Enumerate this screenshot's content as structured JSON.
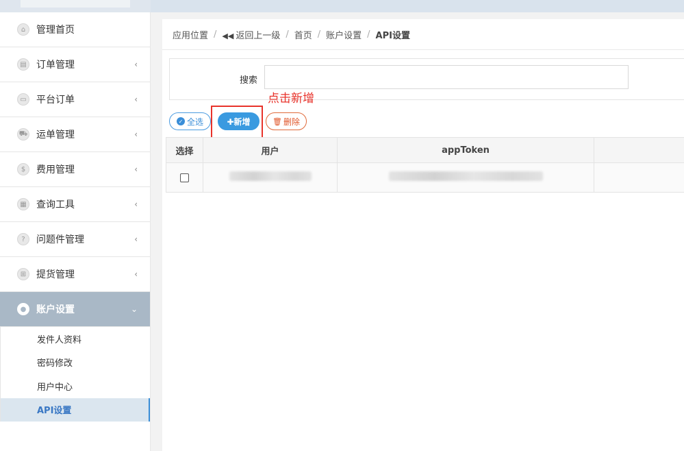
{
  "sidebar": {
    "items": [
      {
        "label": "管理首页",
        "icon": "home-icon",
        "glyph": "⌂",
        "chevron": ""
      },
      {
        "label": "订单管理",
        "icon": "order-icon",
        "glyph": "▤",
        "chevron": "‹"
      },
      {
        "label": "平台订单",
        "icon": "platform-icon",
        "glyph": "▭",
        "chevron": "‹"
      },
      {
        "label": "运单管理",
        "icon": "truck-icon",
        "glyph": "⛟",
        "chevron": "‹"
      },
      {
        "label": "费用管理",
        "icon": "dollar-icon",
        "glyph": "$",
        "chevron": "‹"
      },
      {
        "label": "查询工具",
        "icon": "query-icon",
        "glyph": "▦",
        "chevron": "‹"
      },
      {
        "label": "问题件管理",
        "icon": "question-icon",
        "glyph": "?",
        "chevron": "‹"
      },
      {
        "label": "提货管理",
        "icon": "cart-icon",
        "glyph": "⊞",
        "chevron": "‹"
      },
      {
        "label": "账户设置",
        "icon": "user-icon",
        "glyph": "●",
        "chevron": "⌄"
      }
    ],
    "sub_items": [
      {
        "label": "发件人资料"
      },
      {
        "label": "密码修改"
      },
      {
        "label": "用户中心"
      },
      {
        "label": "API设置"
      }
    ]
  },
  "breadcrumb": {
    "location": "应用位置",
    "back": "返回上一级",
    "home": "首页",
    "account": "账户设置",
    "current": "API设置",
    "sep": "/",
    "back_glyph": "◀◀"
  },
  "search": {
    "label": "搜索",
    "value": ""
  },
  "annotation": {
    "hint": "点击新增"
  },
  "toolbar": {
    "select_all_label": "全选",
    "select_all_glyph": "✓",
    "add_label": "✚新增",
    "delete_label": "删除",
    "delete_glyph": "🗑"
  },
  "table": {
    "headers": [
      "选择",
      "用户",
      "appToken",
      ""
    ]
  },
  "colors": {
    "accent": "#3a9ae0",
    "danger": "#e0562a",
    "annotation": "#e8322a",
    "sidebar_active": "#a9b8c6"
  }
}
